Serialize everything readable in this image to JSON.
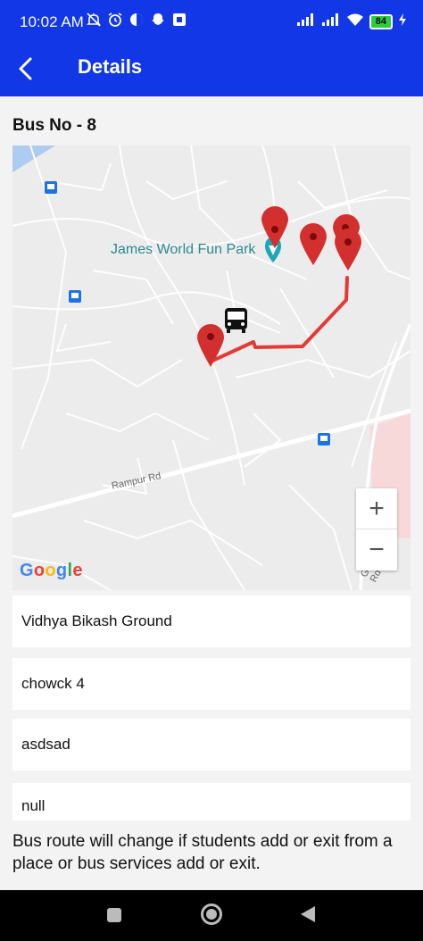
{
  "status_bar": {
    "time": "10:02 AM",
    "battery": "84"
  },
  "app_bar": {
    "title": "Details"
  },
  "bus": {
    "title": "Bus No - 8"
  },
  "map": {
    "park_label": "James World Fun Park",
    "road_label": "Rampur Rd",
    "gita_label": "Gitanagar Rd",
    "zoom_in": "+",
    "zoom_out": "−",
    "route_color": "#e53935",
    "marker_color": "#d32f2f"
  },
  "stops": [
    {
      "name": "Vidhya Bikash Ground"
    },
    {
      "name": "chowck 4"
    },
    {
      "name": "asdsad"
    },
    {
      "name": "null"
    }
  ],
  "note": "Bus route will change if students add or exit from a place or bus services add or exit.",
  "colors": {
    "primary": "#1137e6"
  }
}
